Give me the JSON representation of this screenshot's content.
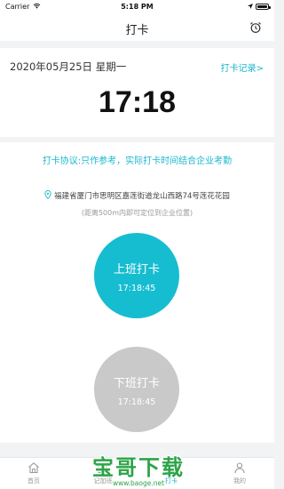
{
  "status_bar": {
    "carrier": "Carrier",
    "time": "5:18 PM"
  },
  "nav": {
    "title": "打卡"
  },
  "date_card": {
    "date": "2020年05月25日 星期一",
    "records_link": "打卡记录>",
    "clock": "17:18"
  },
  "main": {
    "protocol": "打卡协议:只作参考，实际打卡时间结合企业考勤",
    "address": "福建省厦门市思明区嘉莲街道龙山西路74号莲花花园",
    "note": "(距离500m内即可定位到企业位置)",
    "clock_in": {
      "label": "上班打卡",
      "time": "17:18:45"
    },
    "clock_out": {
      "label": "下班打卡",
      "time": "17:18:45"
    }
  },
  "tabs": [
    {
      "label": "首页",
      "icon": "home-icon"
    },
    {
      "label": "记加班",
      "icon": "edit-icon"
    },
    {
      "label": "打卡",
      "icon": "fingerprint-icon"
    },
    {
      "label": "我的",
      "icon": "user-icon"
    }
  ],
  "watermark": {
    "text": "宝哥下载",
    "url": "www.baoge.net"
  },
  "colors": {
    "accent": "#17b7cf",
    "clock_in": "#16bdd0",
    "clock_out": "#c9c9c9",
    "watermark": "#2ca447"
  }
}
